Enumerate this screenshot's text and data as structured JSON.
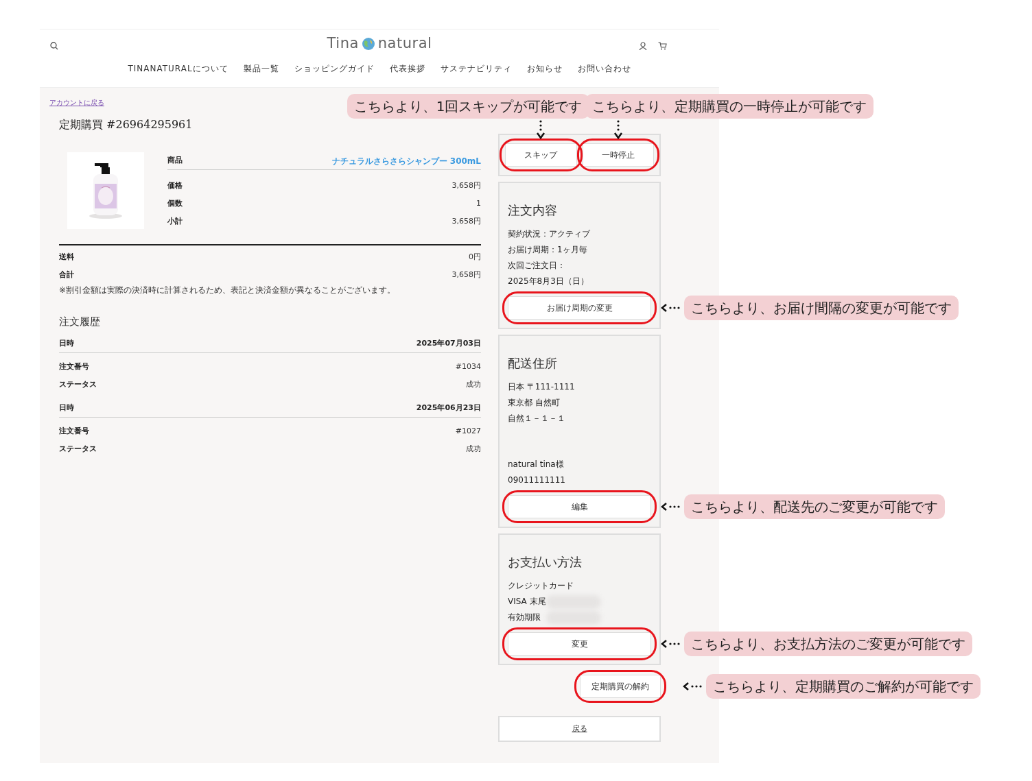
{
  "header": {
    "logo": {
      "left": "Tina",
      "right": "natural"
    },
    "nav": [
      "TINANATURALについて",
      "製品一覧",
      "ショッピングガイド",
      "代表挨拶",
      "サステナビリティ",
      "お知らせ",
      "お問い合わせ"
    ]
  },
  "back_link": "アカウントに戻る",
  "title": "定期購買 #26964295961",
  "product": {
    "header": {
      "label": "商品",
      "value": "ナチュラルさらさらシャンプー 300mL"
    },
    "rows": [
      {
        "label": "価格",
        "value": "3,658円"
      },
      {
        "label": "個数",
        "value": "1"
      },
      {
        "label": "小計",
        "value": "3,658円"
      }
    ]
  },
  "totals": [
    {
      "label": "送料",
      "value": "0円"
    },
    {
      "label": "合計",
      "value": "3,658円"
    }
  ],
  "note": "※割引金額は実際の決済時に計算されるため、表記と決済金額が異なることがございます。",
  "history": {
    "heading": "注文履歴",
    "orders": [
      {
        "date_label": "日時",
        "date": "2025年07月03日",
        "rows": [
          {
            "label": "注文番号",
            "value": "#1034"
          },
          {
            "label": "ステータス",
            "value": "成功"
          }
        ]
      },
      {
        "date_label": "日時",
        "date": "2025年06月23日",
        "rows": [
          {
            "label": "注文番号",
            "value": "#1027"
          },
          {
            "label": "ステータス",
            "value": "成功"
          }
        ]
      }
    ]
  },
  "actions": [
    {
      "label": "スキップ",
      "highlighted": true,
      "annotation": "こちらより、1回スキップが可能です"
    },
    {
      "label": "一時停止",
      "highlighted": true,
      "annotation": "こちらより、定期購買の一時停止が可能です"
    }
  ],
  "cards": [
    {
      "heading": "注文内容",
      "blocks": [
        [
          {
            "text": "契約状況：アクティブ",
            "redacted": false
          },
          {
            "text": "お届け周期：1ヶ月毎",
            "redacted": false
          },
          {
            "text": "次回ご注文日：",
            "redacted": false
          },
          {
            "text": "2025年8月3日（日）",
            "redacted": false
          }
        ]
      ],
      "button": {
        "label": "お届け周期の変更",
        "highlighted": true,
        "annotation": "こちらより、お届け間隔の変更が可能です"
      }
    },
    {
      "heading": "配送住所",
      "blocks": [
        [
          {
            "text": "日本 〒111-1111",
            "redacted": false
          },
          {
            "text": "東京都 自然町",
            "redacted": false
          },
          {
            "text": "自然１－１－１",
            "redacted": false
          }
        ],
        [
          {
            "text": "natural tina様",
            "redacted": false
          },
          {
            "text": "09011111111",
            "redacted": false
          }
        ]
      ],
      "button": {
        "label": "編集",
        "highlighted": true,
        "annotation": "こちらより、配送先のご変更が可能です"
      }
    },
    {
      "heading": "お支払い方法",
      "blocks": [
        [
          {
            "text": "クレジットカード",
            "redacted": false
          },
          {
            "text": "VISA 末尾",
            "redacted": true
          },
          {
            "text": "有効期限",
            "redacted": true
          }
        ]
      ],
      "button": {
        "label": "変更",
        "highlighted": true,
        "annotation": "こちらより、お支払方法のご変更が可能です"
      }
    }
  ],
  "cancel": {
    "label": "定期購買の解約",
    "highlighted": true,
    "annotation": "こちらより、定期購買のご解約が可能です"
  },
  "return_button": {
    "label": "戻る",
    "highlighted": false
  }
}
